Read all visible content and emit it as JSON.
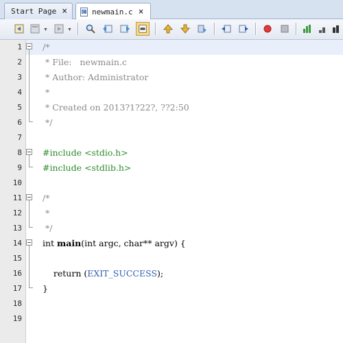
{
  "tabs": [
    {
      "label": "Start Page",
      "close": "×",
      "active": false
    },
    {
      "label": "newmain.c",
      "close": "×",
      "active": true
    }
  ],
  "toolbar": {
    "icons": [
      "back-icon",
      "history-icon",
      "forward-icon",
      "find-icon",
      "find-previous-icon",
      "find-next-icon",
      "toggle-highlight-icon",
      "previous-bookmark-icon",
      "next-bookmark-icon",
      "toggle-bookmark-icon",
      "shift-left-icon",
      "shift-right-icon",
      "record-macro-icon",
      "stop-macro-icon",
      "chart-icon",
      "bar-chart-icon",
      "bar-chart-2-icon"
    ]
  },
  "editor": {
    "lines": [
      {
        "num": "1",
        "text": "/*"
      },
      {
        "num": "2",
        "text": " * File:   newmain.c"
      },
      {
        "num": "3",
        "text": " * Author: Administrator"
      },
      {
        "num": "4",
        "text": " *"
      },
      {
        "num": "5",
        "text": " * Created on 2013?1?22?, ??2:50"
      },
      {
        "num": "6",
        "text": " */"
      },
      {
        "num": "7",
        "text": ""
      },
      {
        "num": "8",
        "pp": "#include",
        "rest": " <stdio.h>"
      },
      {
        "num": "9",
        "pp": "#include",
        "rest": " <stdlib.h>"
      },
      {
        "num": "10",
        "text": ""
      },
      {
        "num": "11",
        "text": "/*"
      },
      {
        "num": "12",
        "text": " *"
      },
      {
        "num": "13",
        "text": " */"
      },
      {
        "num": "14",
        "t1": "int ",
        "fn": "main",
        "t2": "(int argc, char** argv) {"
      },
      {
        "num": "15",
        "text": ""
      },
      {
        "num": "16",
        "t1": "    return (",
        "lit": "EXIT_SUCCESS",
        "t2": ");"
      },
      {
        "num": "17",
        "text": "}"
      },
      {
        "num": "18",
        "text": ""
      },
      {
        "num": "19",
        "text": ""
      }
    ]
  },
  "colors": {
    "comment": "#8a8a8a",
    "preprocessor": "#2f8a2f",
    "literal": "#2f5fb8",
    "current_line": "#e9effa"
  }
}
